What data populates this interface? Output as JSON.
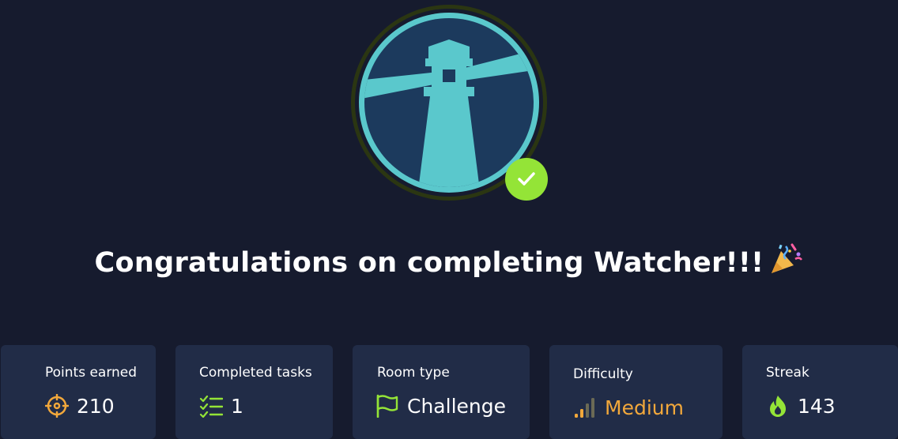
{
  "headline": {
    "text": "Congratulations on completing Watcher!!!",
    "emoji_icon": "party-popper-icon"
  },
  "room_badge": {
    "icon": "lighthouse-icon",
    "colors": {
      "ring": "#3a4a0e",
      "circle_border": "#5ac8cc",
      "inner": "#1d3a5c",
      "lighthouse": "#5ac8cc"
    },
    "completed_icon": "checkmark-icon",
    "completed_color": "#94e437"
  },
  "stats": {
    "points": {
      "label": "Points earned",
      "value": "210",
      "icon": "target-icon",
      "color": "#f2a83b"
    },
    "tasks": {
      "label": "Completed tasks",
      "value": "1",
      "icon": "checklist-icon",
      "color": "#94e437"
    },
    "room_type": {
      "label": "Room type",
      "value": "Challenge",
      "icon": "flag-icon",
      "color": "#94e437"
    },
    "difficulty": {
      "label": "Difficulty",
      "value": "Medium",
      "icon": "signal-bars-icon",
      "color": "#f2a83b"
    },
    "streak": {
      "label": "Streak",
      "value": "143",
      "icon": "flame-icon",
      "color": "#94e437"
    }
  }
}
